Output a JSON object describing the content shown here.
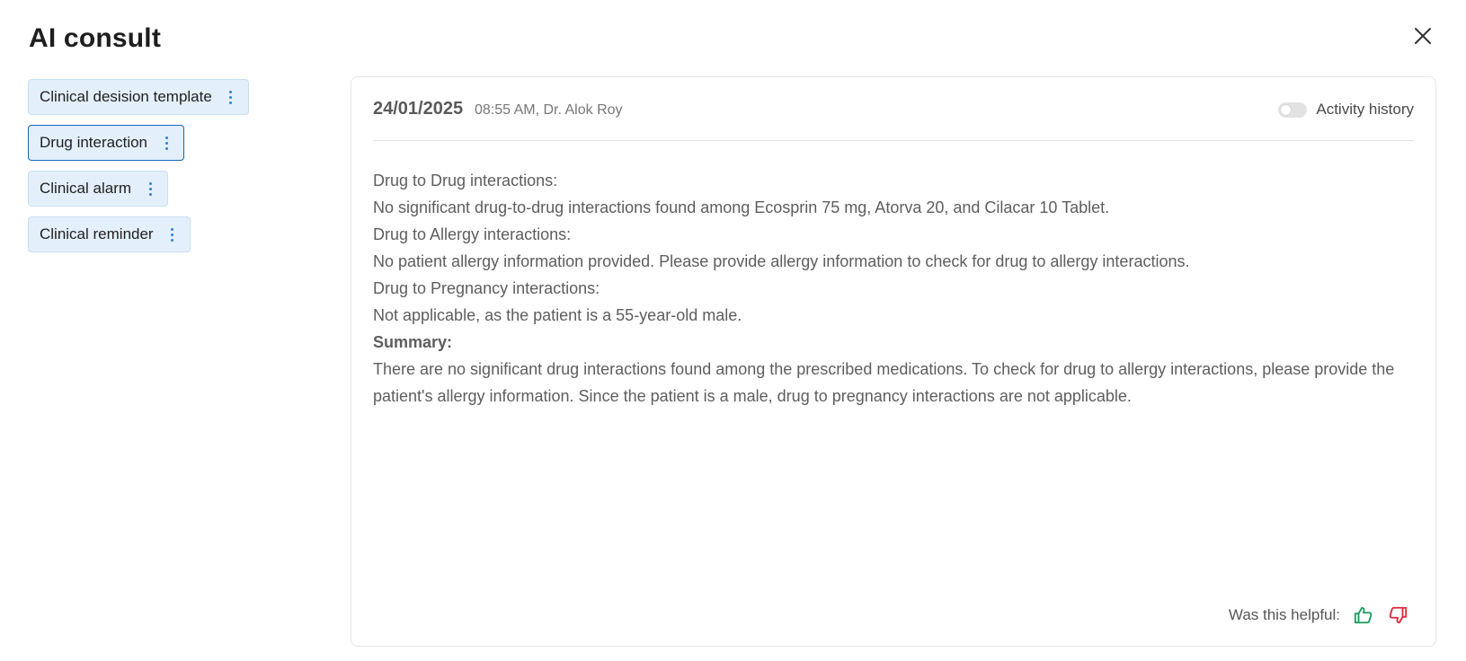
{
  "page": {
    "title": "AI consult"
  },
  "sidebar": {
    "items": [
      {
        "label": "Clinical desision template",
        "active": false
      },
      {
        "label": "Drug interaction",
        "active": true
      },
      {
        "label": "Clinical alarm",
        "active": false
      },
      {
        "label": "Clinical reminder",
        "active": false
      }
    ]
  },
  "panel": {
    "date": "24/01/2025",
    "meta": "08:55 AM, Dr. Alok Roy",
    "activity_history_label": "Activity history",
    "activity_history_enabled": false,
    "content": {
      "line1": "Drug to Drug interactions:",
      "line2": "No significant drug-to-drug interactions found among Ecosprin 75 mg, Atorva 20, and Cilacar 10 Tablet.",
      "line3": "Drug to Allergy interactions:",
      "line4": "No patient allergy information provided. Please provide allergy information to check for drug to allergy interactions.",
      "line5": "Drug to Pregnancy interactions:",
      "line6": "Not applicable, as the patient is a 55-year-old male.",
      "summary_heading": "Summary:",
      "summary_text": "There are no significant drug interactions found among the prescribed medications. To check for drug to allergy interactions, please provide the patient's allergy information. Since the patient is a male, drug to pregnancy interactions are not applicable."
    },
    "feedback": {
      "question": "Was this helpful:",
      "thumbs_up_icon": "thumbs-up-icon",
      "thumbs_down_icon": "thumbs-down-icon",
      "thumbs_up_color": "#1a9a5c",
      "thumbs_down_color": "#e0283a"
    }
  },
  "icons": {
    "close": "close-icon",
    "more": "kebab-icon"
  }
}
